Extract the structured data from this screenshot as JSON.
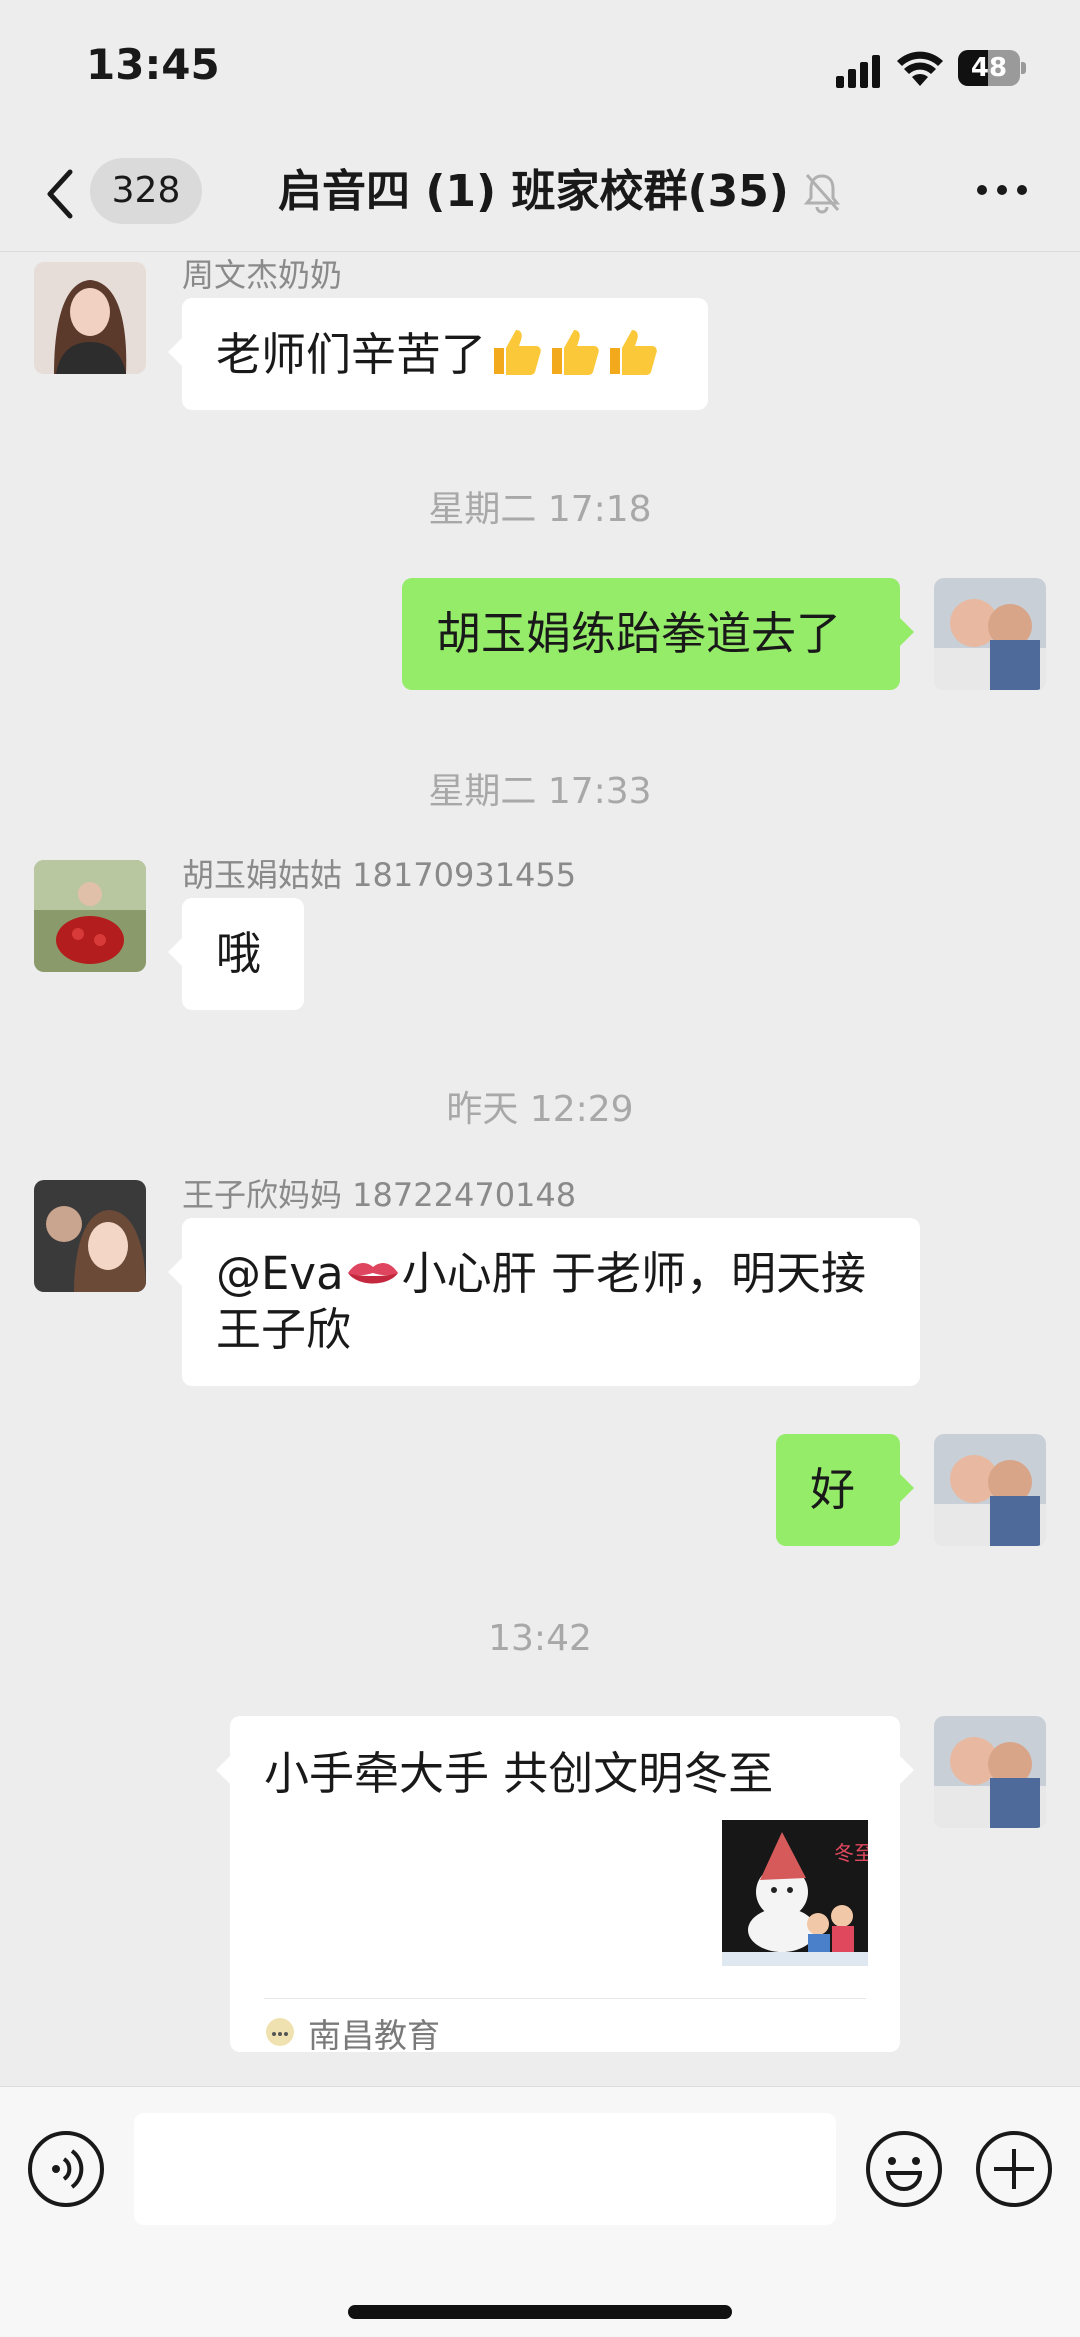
{
  "status_bar": {
    "time": "13:45",
    "battery_text": "48",
    "battery_level": 0.48,
    "icons": [
      "signal-icon",
      "wifi-icon",
      "battery-icon"
    ]
  },
  "nav": {
    "unread_count": "328",
    "title": "启音四 (1) 班家校群(35)",
    "icons": [
      "back-chevron-icon",
      "mute-bell-icon",
      "more-icon"
    ]
  },
  "chat": {
    "msg1": {
      "sender": "周文杰奶奶",
      "text": "老师们辛苦了",
      "emoji": "thumbs-up x3"
    },
    "time1": "星期二 17:18",
    "msg2": {
      "text": "胡玉娟练跆拳道去了"
    },
    "time2": "星期二 17:33",
    "msg3": {
      "sender": "胡玉娟姑姑 18170931455",
      "text": "哦"
    },
    "time3": "昨天 12:29",
    "msg4": {
      "sender": "王子欣妈妈 18722470148",
      "text_before": "@Eva",
      "text_after": "小心肝 于老师，明天接",
      "text_line2": "王子欣",
      "emoji": "lips"
    },
    "msg5": {
      "text": "好"
    },
    "time4": "13:42",
    "msg6": {
      "title": "小手牵大手 共创文明冬至",
      "source": "南昌教育",
      "image_label": "冬至"
    }
  },
  "input_bar": {
    "placeholder": "",
    "icons": [
      "voice-icon",
      "emoji-icon",
      "plus-icon"
    ]
  },
  "colors": {
    "background": "#ededed",
    "green_bubble": "#95ec69",
    "white_bubble": "#ffffff",
    "timestamp": "#a8a8a8"
  }
}
